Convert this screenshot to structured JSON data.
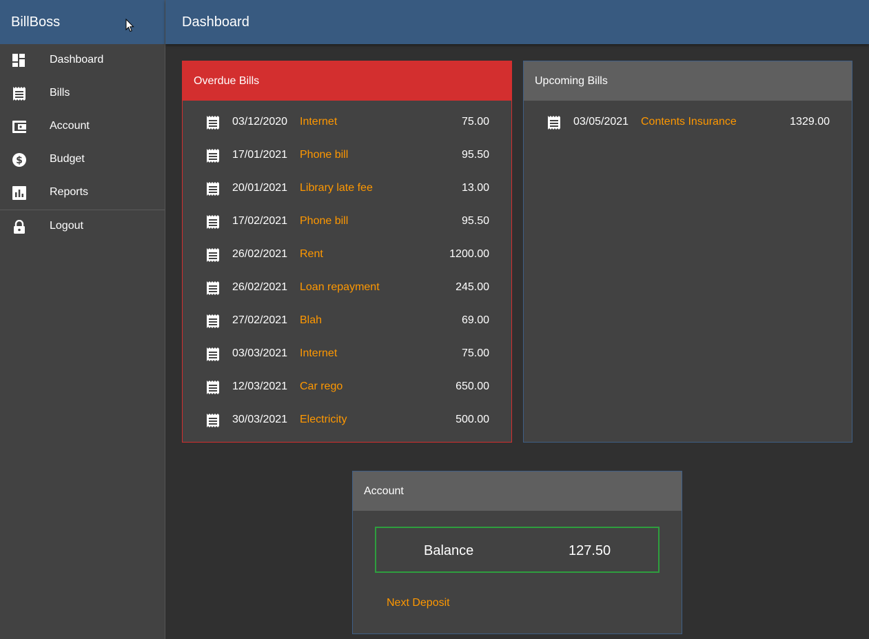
{
  "app": {
    "brand": "BillBoss",
    "page_title": "Dashboard"
  },
  "sidebar": {
    "items": [
      {
        "label": "Dashboard",
        "icon": "dashboard-icon"
      },
      {
        "label": "Bills",
        "icon": "receipt-icon"
      },
      {
        "label": "Account",
        "icon": "wallet-icon"
      },
      {
        "label": "Budget",
        "icon": "dollar-circle-icon"
      },
      {
        "label": "Reports",
        "icon": "bar-chart-icon"
      }
    ],
    "logout": {
      "label": "Logout",
      "icon": "lock-icon"
    }
  },
  "overdue": {
    "title": "Overdue Bills",
    "bills": [
      {
        "date": "03/12/2020",
        "name": "Internet",
        "amount": "75.00"
      },
      {
        "date": "17/01/2021",
        "name": "Phone bill",
        "amount": "95.50"
      },
      {
        "date": "20/01/2021",
        "name": "Library late fee",
        "amount": "13.00"
      },
      {
        "date": "17/02/2021",
        "name": "Phone bill",
        "amount": "95.50"
      },
      {
        "date": "26/02/2021",
        "name": "Rent",
        "amount": "1200.00"
      },
      {
        "date": "26/02/2021",
        "name": "Loan repayment",
        "amount": "245.00"
      },
      {
        "date": "27/02/2021",
        "name": "Blah",
        "amount": "69.00"
      },
      {
        "date": "03/03/2021",
        "name": "Internet",
        "amount": "75.00"
      },
      {
        "date": "12/03/2021",
        "name": "Car rego",
        "amount": "650.00"
      },
      {
        "date": "30/03/2021",
        "name": "Electricity",
        "amount": "500.00"
      }
    ]
  },
  "upcoming": {
    "title": "Upcoming Bills",
    "bills": [
      {
        "date": "03/05/2021",
        "name": "Contents Insurance",
        "amount": "1329.00"
      }
    ]
  },
  "account": {
    "title": "Account",
    "balance_label": "Balance",
    "balance_value": "127.50",
    "next_deposit_label": "Next Deposit"
  },
  "colors": {
    "header": "#385a80",
    "overdue": "#d32f2f",
    "link": "#ff9800",
    "balance_border": "#2e9e3e"
  }
}
